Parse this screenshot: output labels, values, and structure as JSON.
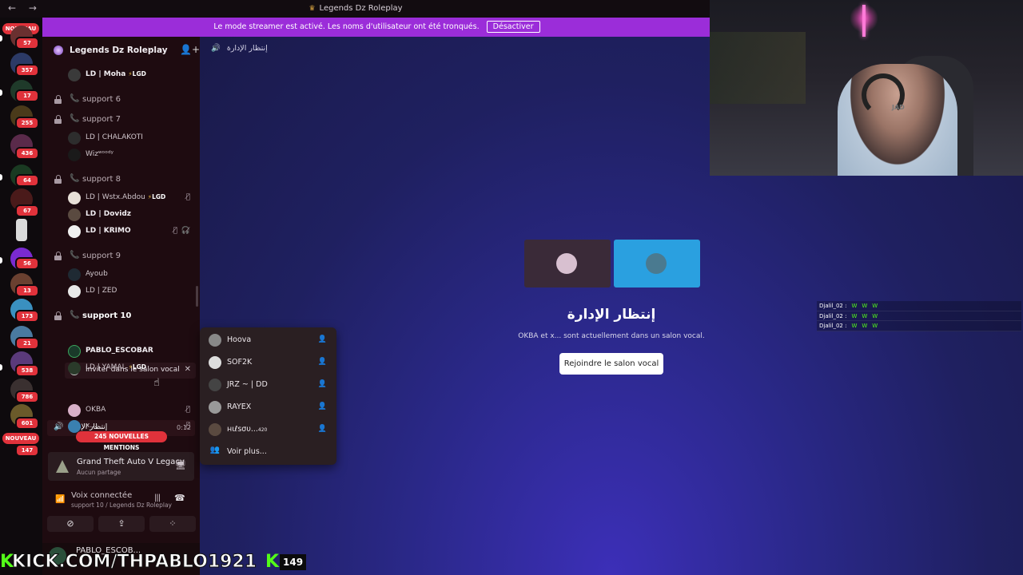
{
  "window": {
    "title": "Legends Dz Roleplay",
    "nav": "← →"
  },
  "banner": {
    "text": "Le mode streamer est activé. Les noms d'utilisateur ont été tronqués.",
    "button": "Désactiver"
  },
  "rail": {
    "new_badge": "NOUVEAU",
    "counts": [
      "57",
      "357",
      "17",
      "255",
      "436",
      "64",
      "67",
      "56",
      "13",
      "173",
      "21",
      "538",
      "786",
      "601"
    ],
    "bottom_badge": "NOUVEAU",
    "bottom_count": "147"
  },
  "server": {
    "name": "Legends Dz Roleplay",
    "chevron": "⌵",
    "add": "👤+"
  },
  "sidebar": {
    "tag": "LGD",
    "u_moha": "LD | Moha",
    "ch_support6": "support 6",
    "ch_support7": "support 7",
    "u_chalakoti": "LD | CHALAKOTI",
    "u_wiz": "Wizʷᵒᵒᵈʸ",
    "ch_support8": "support 8",
    "u_wstx": "LD | Wstx.Abdou",
    "u_dovidz": "LD | Dovidz",
    "u_krimo": "LD | KRIMO",
    "ch_support9": "support 9",
    "u_ayoub": "Ayoub",
    "u_zed": "LD | ZED",
    "ch_support10": "support 10",
    "invite_label": "Inviter dans le salon vocal",
    "u_pablo": "PABLO_ESCOBAR",
    "u_yamal": "LD | YAMAL",
    "vc_name": "إنتظار الإدارة",
    "vc_time": "0:12",
    "u_okba": "OKBA",
    "u_x": "x...",
    "mentions": "245 NOUVELLES MENTIONS"
  },
  "activity": {
    "game": "Grand Theft Auto V Legacy",
    "sub": "Aucun partage"
  },
  "voice": {
    "title": "Voix connectée",
    "sub": "support 10 / Legends Dz Roleplay"
  },
  "userbar": {
    "name": "PABLO_ESCOB..."
  },
  "main": {
    "header": "إنتظار الإدارة",
    "vc_title": "إنتظار الإدارة",
    "vc_desc": "OKBA et x... sont actuellement dans un salon vocal.",
    "join": "Rejoindre le salon vocal"
  },
  "popup": {
    "items": [
      "Hoova",
      "SOF2K",
      "JRZ ~ | DD",
      "RAYEX",
      "нιℓѕσυ...",
      "Voir plus..."
    ],
    "suffix": "420"
  },
  "webcam": {
    "brand": "JAD"
  },
  "chat": [
    {
      "user": "Djalil_02 :",
      "msg": [
        "W",
        "W",
        "W"
      ]
    },
    {
      "user": "Djalil_02 :",
      "msg": [
        "W",
        "W",
        "W"
      ]
    },
    {
      "user": "Djalil_02 :",
      "msg": [
        "W",
        "W",
        "W"
      ]
    }
  ],
  "kick": {
    "prefix": "K",
    "url": "KICK.COM/THPABLO1921",
    "suffix": "K",
    "viewers": "149"
  },
  "colors": {
    "accent": "#9b2dd9",
    "badge": "#e0323b",
    "kick_green": "#53fc18",
    "sidebar": "#1e0b10"
  }
}
